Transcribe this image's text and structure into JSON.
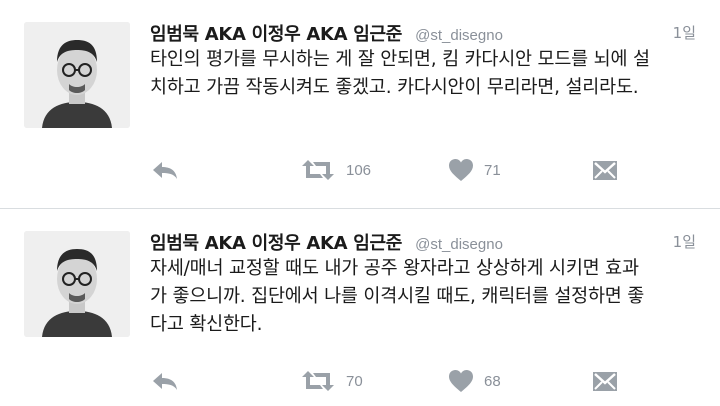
{
  "tweets": [
    {
      "display_name": "임범묵 AKA 이정우 AKA 임근준",
      "handle": "@st_disegno",
      "time": "1일",
      "text_lines": [
        "타인의 평가를 무시하는 게 잘 안되면, 킴 카다시안 모드를 뇌에 설",
        "치하고 가끔 작동시켜도 좋겠고. 카다시안이 무리라면, 설리라도."
      ],
      "retweet_count": "106",
      "like_count": "71"
    },
    {
      "display_name": "임범묵 AKA 이정우 AKA 임근준",
      "handle": "@st_disegno",
      "time": "1일",
      "text_lines": [
        "자세/매너 교정할 때도 내가 공주 왕자라고 상상하게 시키면 효과",
        "가 좋으니까. 집단에서 나를 이격시킬 때도, 캐릭터를 설정하면 좋",
        "다고 확신한다."
      ],
      "retweet_count": "70",
      "like_count": "68"
    }
  ],
  "icons": {
    "reply": "reply-icon",
    "retweet": "retweet-icon",
    "like": "heart-icon",
    "dm": "direct-message-icon"
  },
  "colors": {
    "icon": "#9aa1a8",
    "text": "#1b1b1b",
    "meta": "#8a9099",
    "divider": "#d9dde0"
  }
}
